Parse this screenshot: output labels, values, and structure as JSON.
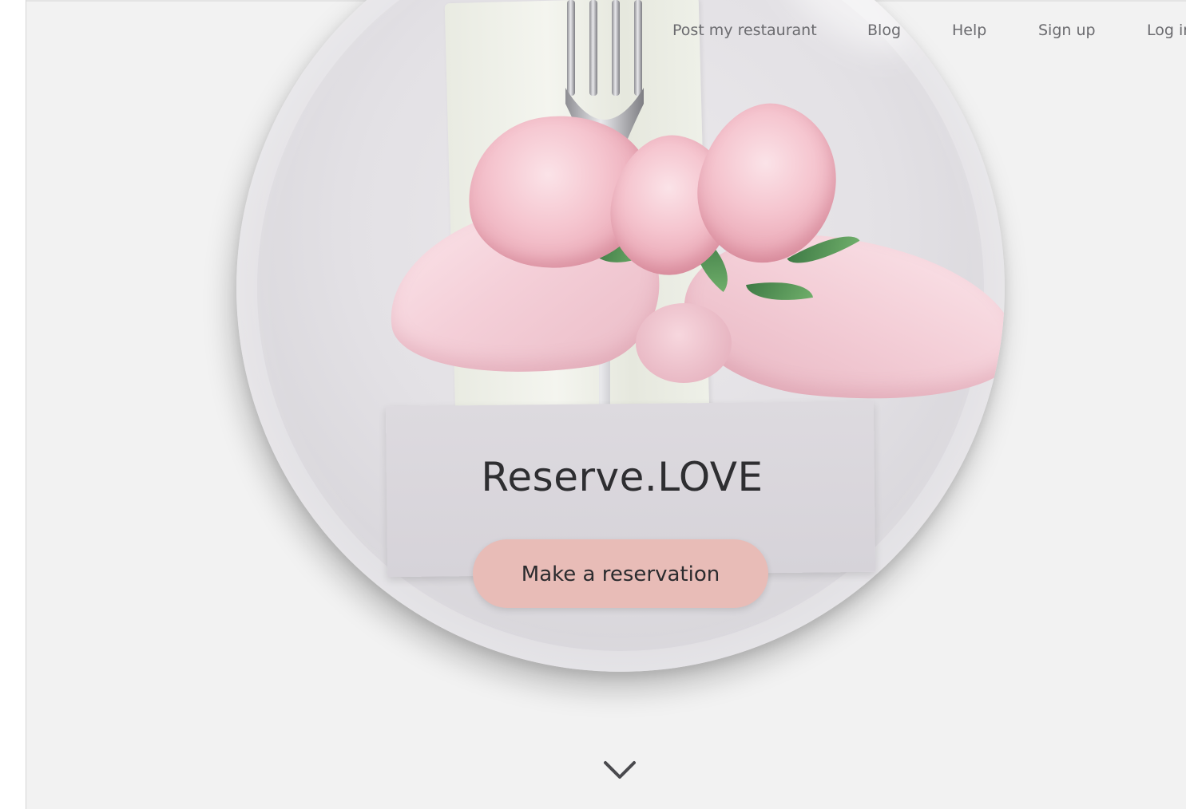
{
  "nav": {
    "items": [
      {
        "label": "Post my restaurant"
      },
      {
        "label": "Blog"
      },
      {
        "label": "Help"
      },
      {
        "label": "Sign up"
      },
      {
        "label": "Log in"
      }
    ]
  },
  "hero": {
    "brand_title": "Reserve.LOVE",
    "cta_label": "Make a reservation"
  },
  "icons": {
    "scroll_down": "chevron-down-icon"
  },
  "colors": {
    "background": "#f2f2f2",
    "cta_background": "#e8bcb7",
    "nav_text": "#6b6b6f",
    "title_text": "#2e2e31"
  }
}
